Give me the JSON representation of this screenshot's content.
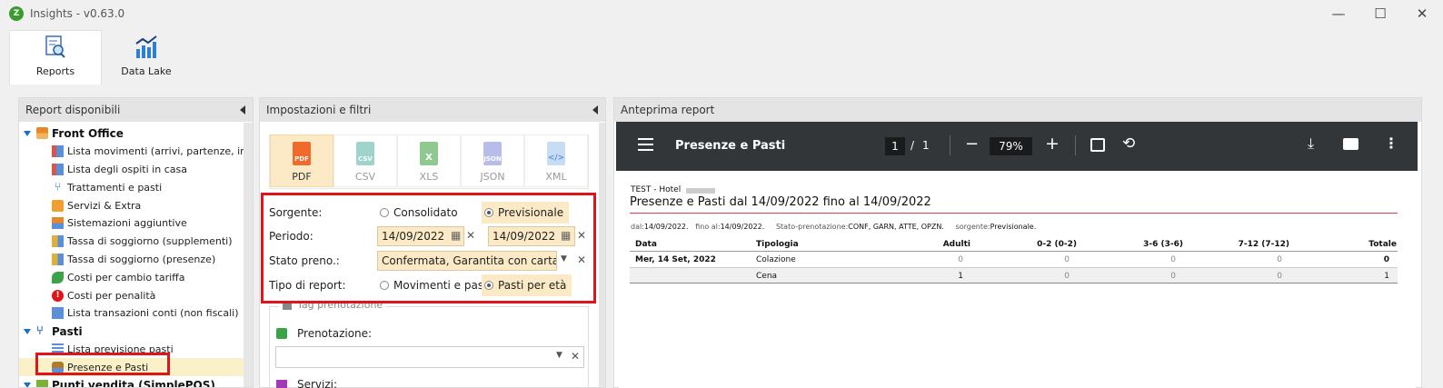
{
  "window": {
    "title": "Insights - v0.63.0",
    "minimize": "—",
    "maximize": "☐",
    "close": "✕"
  },
  "ribbon": {
    "tabs": [
      {
        "label": "Reports",
        "icon": "reports-icon"
      },
      {
        "label": "Data Lake",
        "icon": "data-lake-icon"
      }
    ]
  },
  "left_panel": {
    "title": "Report disponibili",
    "groups": [
      {
        "label": "Front Office",
        "items": [
          "Lista movimenti (arrivi, partenze, in c...",
          "Lista degli ospiti in casa",
          "Trattamenti e pasti",
          "Servizi & Extra",
          "Sistemazioni aggiuntive",
          "Tassa di soggiorno (supplementi)",
          "Tassa di soggiorno (presenze)",
          "Costi per cambio tariffa",
          "Costi per penalità",
          "Lista transazioni conti (non fiscali)"
        ]
      },
      {
        "label": "Pasti",
        "items": [
          "Lista previsione pasti",
          "Presenze e Pasti"
        ]
      },
      {
        "label": "Punti vendita (SimplePOS)",
        "items": []
      }
    ],
    "selected": "Presenze e Pasti"
  },
  "mid_panel": {
    "title": "Impostazioni e filtri",
    "formats": [
      "PDF",
      "CSV",
      "XLS",
      "JSON",
      "XML"
    ],
    "active_format": "PDF",
    "sorgente_label": "Sorgente:",
    "sorgente_options": [
      "Consolidato",
      "Previsionale"
    ],
    "sorgente_selected": "Previsionale",
    "periodo_label": "Periodo:",
    "periodo_from": "14/09/2022",
    "periodo_to": "14/09/2022",
    "stato_label": "Stato preno.:",
    "stato_value": "Confermata, Garantita con carta di cr",
    "tipo_label": "Tipo di report:",
    "tipo_options": [
      "Movimenti e pasti",
      "Pasti per età"
    ],
    "tipo_selected": "Pasti per età",
    "tag_label": "Tag prenotazione",
    "prenotazione_label": "Prenotazione:",
    "next_label": "Servizi:"
  },
  "preview": {
    "title": "Anteprima report",
    "doc_title": "Presenze e Pasti",
    "page_current": "1",
    "page_sep": "/",
    "page_total": "1",
    "zoom": "79%",
    "hotel": "TEST - Hotel",
    "heading": "Presenze e Pasti dal 14/09/2022 fino al 14/09/2022",
    "filters": {
      "dal_label": "dal:",
      "dal": "14/09/2022.",
      "al_label": "fino al:",
      "al": "14/09/2022.",
      "stato_label": "Stato-prenotazione:",
      "stato": "CONF, GARN, ATTE, OPZN.",
      "sorgente_label": "sorgente:",
      "sorgente": "Previsionale."
    },
    "columns": [
      "Data",
      "Tipologia",
      "Adulti",
      "0-2 (0-2)",
      "3-6 (3-6)",
      "7-12 (7-12)",
      "Totale"
    ],
    "rows": [
      {
        "data": "Mer, 14 Set, 2022",
        "tipologia": "Colazione",
        "adulti": "0",
        "c02": "0",
        "c36": "0",
        "c712": "0",
        "totale": "0"
      },
      {
        "data": "",
        "tipologia": "Cena",
        "adulti": "1",
        "c02": "0",
        "c36": "0",
        "c712": "0",
        "totale": "1"
      }
    ]
  },
  "colors": {
    "accent_red": "#e0141b",
    "highlight": "#fbeac5",
    "pdf_toolbar": "#323639",
    "link_red": "#e8384f"
  }
}
